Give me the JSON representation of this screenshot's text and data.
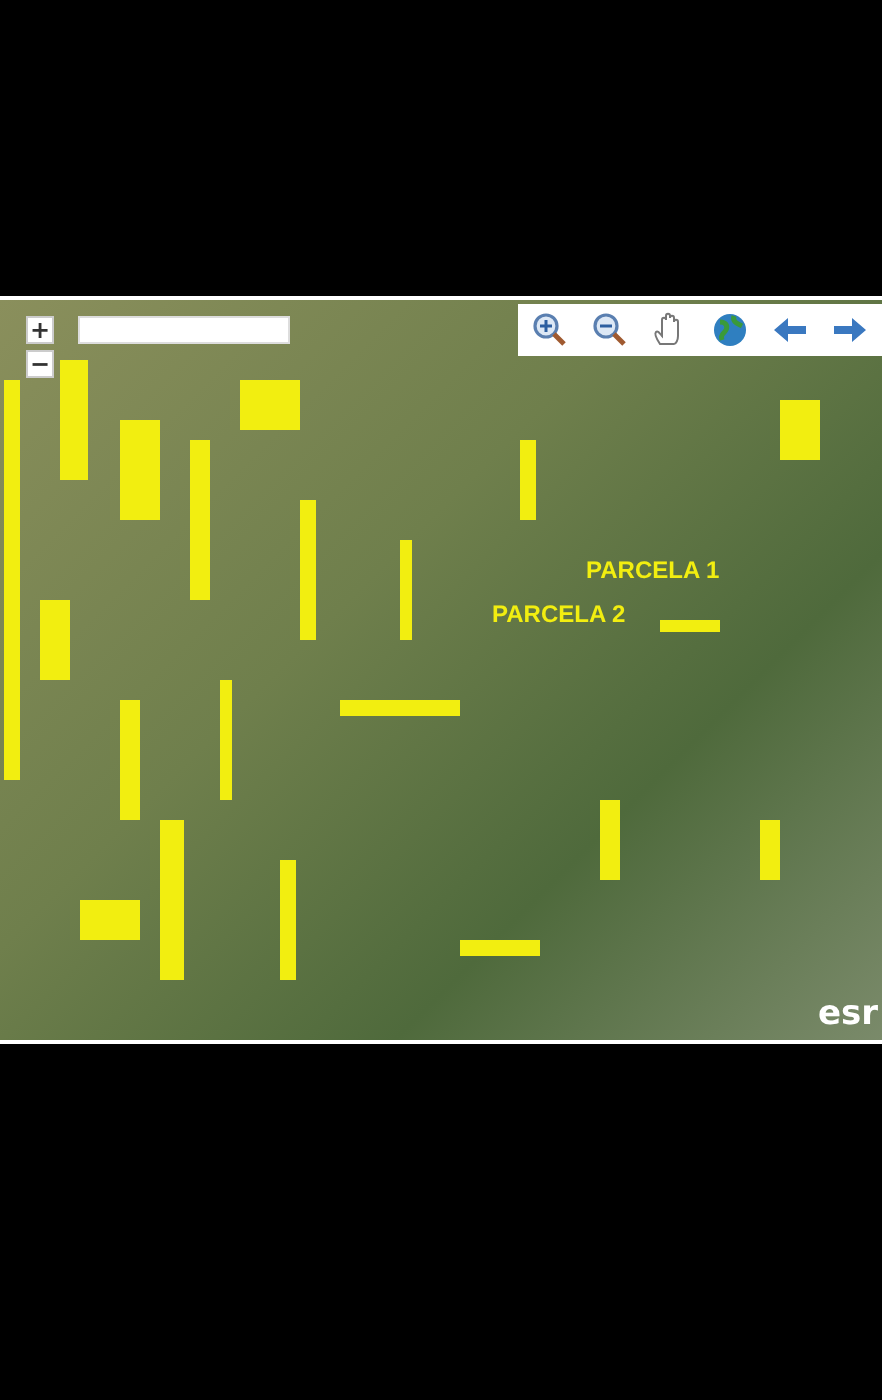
{
  "map": {
    "zoom_buttons": [
      "+",
      "−"
    ],
    "toolbar": [
      {
        "kind": "zoom-in"
      },
      {
        "kind": "zoom-out"
      },
      {
        "kind": "pan"
      },
      {
        "kind": "globe"
      },
      {
        "kind": "back"
      },
      {
        "kind": "forward"
      }
    ],
    "labels": [
      {
        "text": "PARCELA 1"
      },
      {
        "text": "PARCELA 2"
      }
    ],
    "attribution": "esr"
  }
}
